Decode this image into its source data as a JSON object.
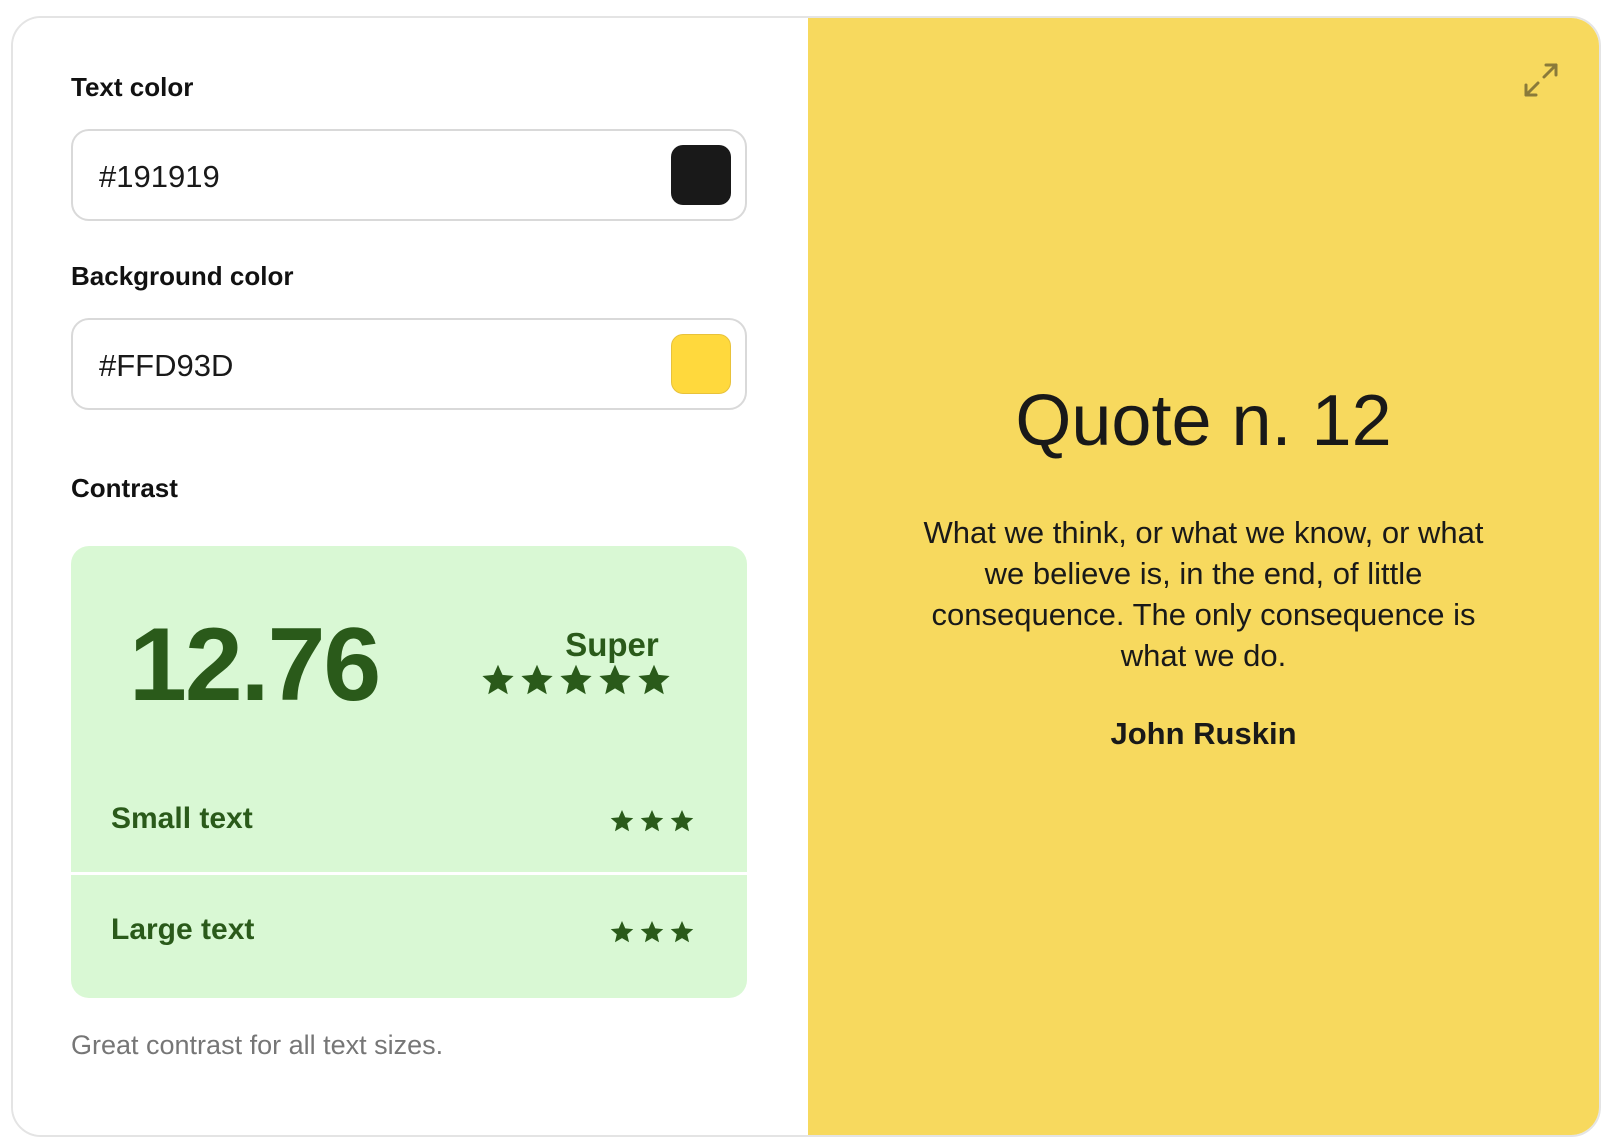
{
  "colors": {
    "text": "#191919",
    "background": "#FFD93D",
    "accent_green": "#2a5a1a",
    "contrast_bg": "#d9f8d4"
  },
  "text_color": {
    "label": "Text color",
    "value": "#191919",
    "swatch": "#191919"
  },
  "background_color": {
    "label": "Background color",
    "value": "#FFD93D",
    "swatch": "#FFD93D"
  },
  "contrast": {
    "label": "Contrast",
    "ratio": "12.76",
    "rating": "Super",
    "rating_stars": 5,
    "rows": [
      {
        "label": "Small text",
        "stars": 3
      },
      {
        "label": "Large text",
        "stars": 3
      }
    ],
    "message": "Great contrast for all text sizes."
  },
  "preview": {
    "expand_icon": "expand-icon",
    "title": "Quote n. 12",
    "quote": "What we think, or what we know, or what we believe is, in the end, of little consequence. The only consequence is what we do.",
    "author": "John Ruskin"
  }
}
